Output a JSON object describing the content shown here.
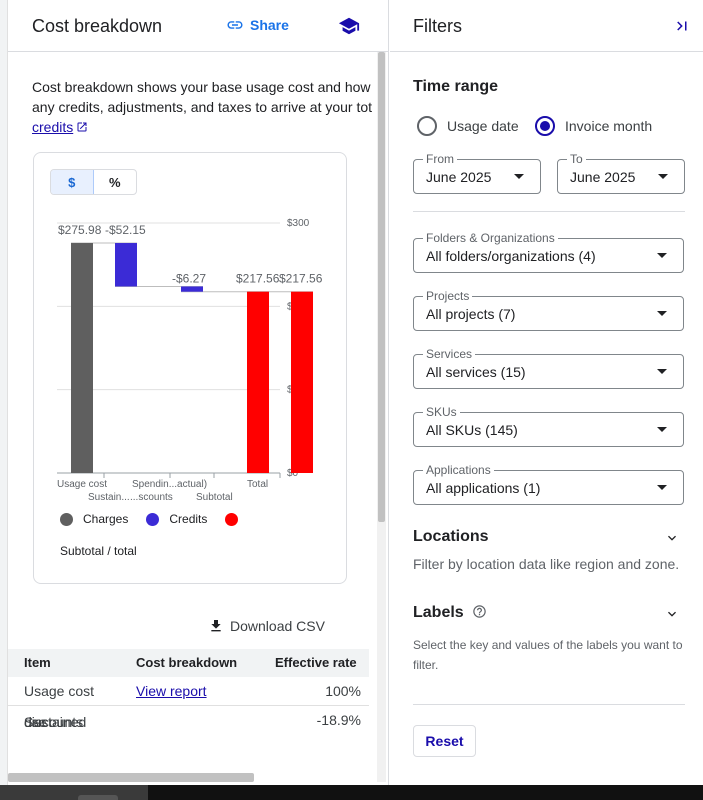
{
  "left": {
    "title": "Cost breakdown",
    "share_label": "Share",
    "description_line1": "Cost breakdown shows your base usage cost and how",
    "description_line2": "any credits, adjustments, and taxes to arrive at your tot",
    "description_link": "credits"
  },
  "toggle": {
    "dollar": "$",
    "percent": "%"
  },
  "chart_data": {
    "type": "bar",
    "categories": [
      "Usage cost",
      "Sustain...",
      "Spendin...actual)",
      "...scounts",
      "Subtotal",
      "Total"
    ],
    "x_tick_labels_row1": [
      "Usage cost",
      "Spendin...actual)",
      "Total"
    ],
    "x_tick_labels_row2": [
      "Sustain...",
      "...scounts",
      "Subtotal"
    ],
    "values": [
      275.98,
      -52.15,
      -6.27,
      0,
      217.56,
      217.56
    ],
    "value_labels": [
      "$275.98",
      "-$52.15",
      "-$6.27",
      "$217.56",
      "$217.56"
    ],
    "y_ticks": [
      "$300",
      "$200",
      "$100",
      "$0"
    ],
    "ylim": [
      0,
      300
    ],
    "series": [
      {
        "name": "Charges",
        "color": "#5f5f5f"
      },
      {
        "name": "Credits",
        "color": "#3b2bd6"
      },
      {
        "name": "Subtotal / total",
        "color": "#ff0000"
      }
    ]
  },
  "legend": {
    "charges": "Charges",
    "credits": "Credits",
    "subtotal": "Subtotal / total"
  },
  "download_label": "Download CSV",
  "table": {
    "headers": [
      "Item",
      "Cost breakdown",
      "Effective rate"
    ],
    "rows": [
      {
        "item": "Usage cost",
        "breakdown": "View report",
        "rate": "100%"
      },
      {
        "item_line1": "Sustained",
        "item_line2": "use",
        "item_line3": "discounts",
        "breakdown": "",
        "rate": "-18.9%"
      }
    ]
  },
  "filters": {
    "title": "Filters",
    "time_range": "Time range",
    "usage_date": "Usage date",
    "invoice_month": "Invoice month",
    "from_label": "From",
    "from_value": "June 2025",
    "to_label": "To",
    "to_value": "June 2025",
    "folders_label": "Folders & Organizations",
    "folders_value": "All folders/organizations (4)",
    "projects_label": "Projects",
    "projects_value": "All projects (7)",
    "services_label": "Services",
    "services_value": "All services (15)",
    "skus_label": "SKUs",
    "skus_value": "All SKUs (145)",
    "applications_label": "Applications",
    "applications_value": "All applications (1)",
    "locations_title": "Locations",
    "locations_desc": "Filter by location data like region and zone.",
    "labels_title": "Labels",
    "labels_desc_line1": "Select the key and values of the labels you want to",
    "labels_desc_line2": "filter.",
    "reset_label": "Reset"
  },
  "colors": {
    "accent": "#1a73e8",
    "link": "#1a0dab",
    "charges": "#5f5f5f",
    "credits": "#3b2bd6",
    "subtotal": "#ff0000"
  }
}
